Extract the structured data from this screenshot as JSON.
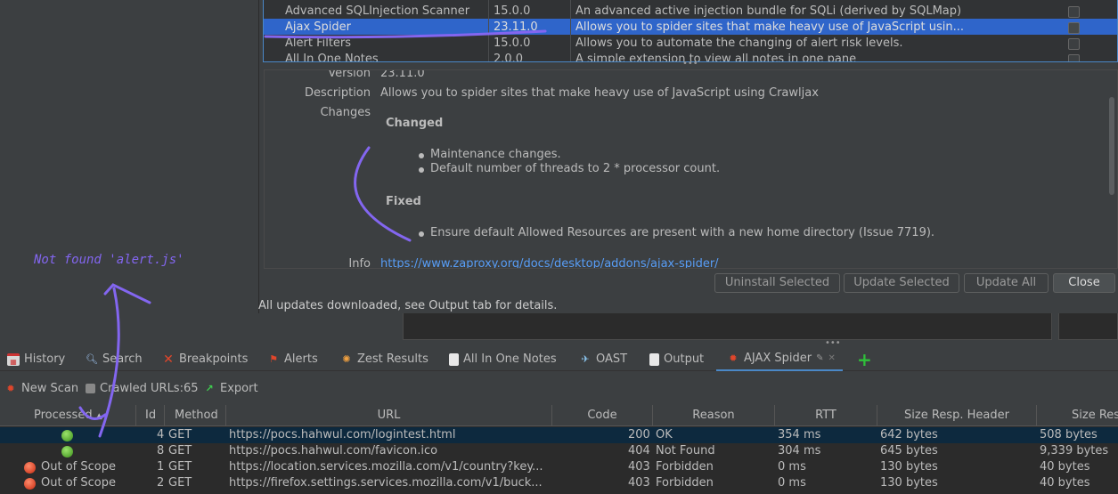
{
  "colors": {
    "accent": "#4a88c7",
    "annotation": "#8366f0",
    "selection": "#2f65ca"
  },
  "addons": {
    "rows": [
      {
        "name": "Advanced SQLInjection Scanner",
        "version": "15.0.0",
        "description": "An advanced active injection bundle for SQLi (derived by SQLMap)"
      },
      {
        "name": "Ajax Spider",
        "version": "23.11.0",
        "description": "Allows you to spider sites that make heavy use of JavaScript usin..."
      },
      {
        "name": "Alert Filters",
        "version": "15.0.0",
        "description": "Allows you to automate the changing of alert risk levels."
      },
      {
        "name": "All In One Notes",
        "version": "2.0.0",
        "description": "A simple extension to view all notes in one pane"
      }
    ],
    "splitter": "•••"
  },
  "detail": {
    "version_label": "Version",
    "version_value": "23.11.0",
    "description_label": "Description",
    "description_value": "Allows you to spider sites that make heavy use of JavaScript using Crawljax",
    "changes_label": "Changes",
    "changed_heading": "Changed",
    "changed_items": [
      "Maintenance changes.",
      "Default number of threads to 2 * processor count."
    ],
    "fixed_heading": "Fixed",
    "fixed_items": [
      "Ensure default Allowed Resources are present with a new home directory (Issue 7719)."
    ],
    "info_label": "Info",
    "info_link": "https://www.zaproxy.org/docs/desktop/addons/ajax-spider/"
  },
  "buttons": {
    "uninstall": "Uninstall Selected",
    "update_selected": "Update Selected",
    "update_all": "Update All",
    "close": "Close"
  },
  "status_message": "All updates downloaded, see Output tab for details.",
  "annotation_note": "Not found 'alert.js'",
  "tabs": [
    {
      "label": "History",
      "icon": "calendar-icon"
    },
    {
      "label": "Search",
      "icon": "search-icon"
    },
    {
      "label": "Breakpoints",
      "icon": "breakpoints-icon"
    },
    {
      "label": "Alerts",
      "icon": "flag-icon"
    },
    {
      "label": "Zest Results",
      "icon": "zest-icon"
    },
    {
      "label": "All In One Notes",
      "icon": "notes-icon"
    },
    {
      "label": "OAST",
      "icon": "oast-icon"
    },
    {
      "label": "Output",
      "icon": "output-icon"
    },
    {
      "label": "AJAX Spider",
      "icon": "spider-icon"
    }
  ],
  "toolbar": {
    "new_scan": "New Scan",
    "crawled_urls": "Crawled URLs:65",
    "export": "Export"
  },
  "results": {
    "columns": [
      "Processed",
      "Id",
      "Method",
      "URL",
      "Code",
      "Reason",
      "RTT",
      "Size Resp. Header",
      "Size Res"
    ],
    "rows": [
      {
        "processed": "",
        "status": "green",
        "id": "4",
        "method": "GET",
        "url": "https://pocs.hahwul.com/logintest.html",
        "code": "200",
        "reason": "OK",
        "rtt": "354 ms",
        "size_header": "642 bytes",
        "size_body": "508 bytes"
      },
      {
        "processed": "",
        "status": "green",
        "id": "8",
        "method": "GET",
        "url": "https://pocs.hahwul.com/favicon.ico",
        "code": "404",
        "reason": "Not Found",
        "rtt": "304 ms",
        "size_header": "645 bytes",
        "size_body": "9,339 bytes"
      },
      {
        "processed": "Out of Scope",
        "status": "red",
        "id": "1",
        "method": "GET",
        "url": "https://location.services.mozilla.com/v1/country?key...",
        "code": "403",
        "reason": "Forbidden",
        "rtt": "0 ms",
        "size_header": "130 bytes",
        "size_body": "40 bytes"
      },
      {
        "processed": "Out of Scope",
        "status": "red",
        "id": "2",
        "method": "GET",
        "url": "https://firefox.settings.services.mozilla.com/v1/buck...",
        "code": "403",
        "reason": "Forbidden",
        "rtt": "0 ms",
        "size_header": "130 bytes",
        "size_body": "40 bytes"
      }
    ]
  }
}
